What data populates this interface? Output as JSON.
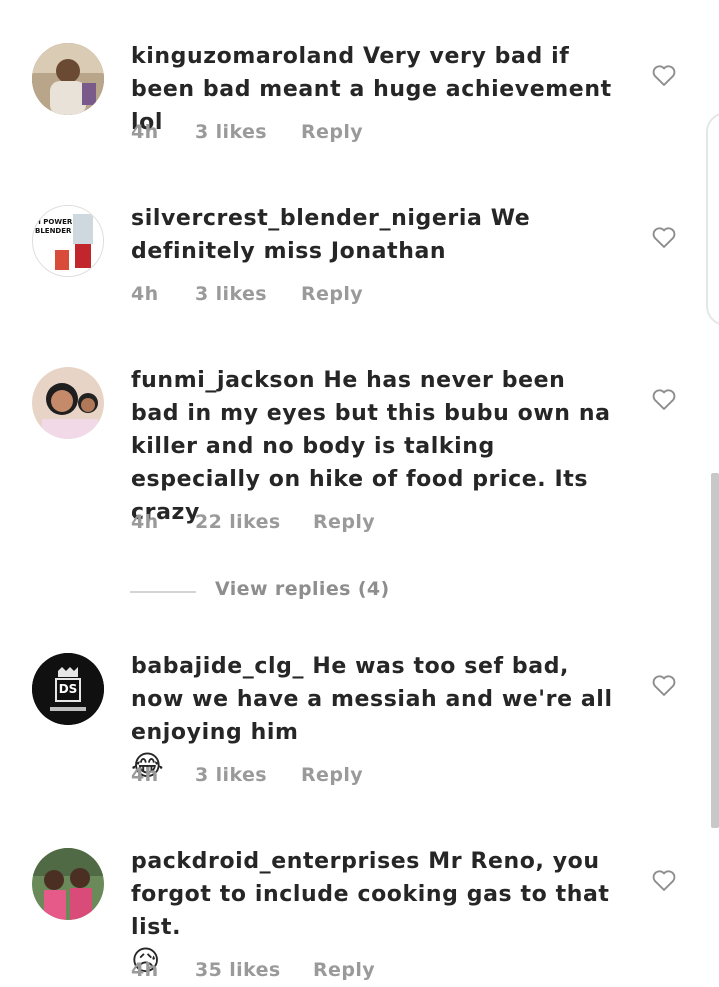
{
  "comments": [
    {
      "username": "kinguzomaroland",
      "text": "Very very bad if been bad meant a huge achievement lol",
      "emoji": "",
      "time": "4h",
      "likes": "3 likes",
      "reply": "Reply",
      "avatar_icon": "profile-photo"
    },
    {
      "username": "silvercrest_blender_nigeria",
      "text": "We definitely miss Jonathan",
      "emoji": "",
      "time": "4h",
      "likes": "3 likes",
      "reply": "Reply",
      "avatar_icon": "blender-product-photo",
      "avatar_label_1": "H POWER",
      "avatar_label_2": "BLENDER"
    },
    {
      "username": "funmi_jackson",
      "text": "He has never been bad in my eyes but this bubu own na killer and no body is talking especially on hike of food price. Its crazy",
      "emoji": "",
      "time": "4h",
      "likes": "22 likes",
      "reply": "Reply",
      "avatar_icon": "profile-photo"
    },
    {
      "username": "babajide_clg_",
      "text": "He was too sef bad, now we have a messiah and we're all enjoying him",
      "emoji": "😂",
      "time": "4h",
      "likes": "3 likes",
      "reply": "Reply",
      "avatar_icon": "logo-avatar",
      "avatar_label_1": "DS"
    },
    {
      "username": "packdroid_enterprises",
      "text": "Mr Reno, you forgot to include cooking gas to that list.",
      "emoji": "😥",
      "time": "4h",
      "likes": "35 likes",
      "reply": "Reply",
      "avatar_icon": "profile-photo"
    }
  ],
  "view_replies": "View replies (4)",
  "colors": {
    "text": "#262626",
    "meta": "#9a9a9a",
    "heart": "#8e8e8e"
  }
}
